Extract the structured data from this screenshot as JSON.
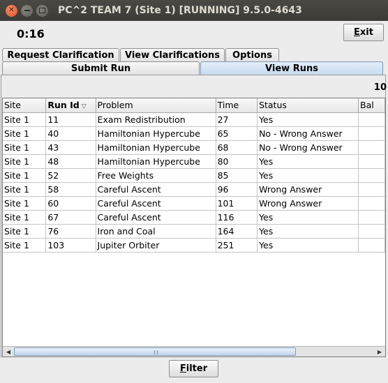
{
  "window": {
    "title": "PC^2 TEAM 7 (Site 1) [RUNNING] 9.5.0-4643"
  },
  "clock": "0:16",
  "buttons": {
    "exit_prefix": "E",
    "exit_rest": "xit",
    "filter_prefix": "F",
    "filter_rest": "ilter"
  },
  "tabs": {
    "row1": [
      "Request Clarification",
      "View Clarifications",
      "Options"
    ],
    "row2": [
      "Submit Run",
      "View Runs"
    ],
    "active": "View Runs"
  },
  "run_count": "10",
  "runs_table": {
    "sort_indicator": "▽",
    "columns": [
      "Site",
      "Run Id",
      "Problem",
      "Time",
      "Status",
      "Bal"
    ],
    "rows": [
      [
        "Site 1",
        "11",
        "Exam Redistribution",
        "27",
        "Yes"
      ],
      [
        "Site 1",
        "40",
        "Hamiltonian Hypercube",
        "65",
        "No - Wrong Answer"
      ],
      [
        "Site 1",
        "43",
        "Hamiltonian Hypercube",
        "68",
        "No - Wrong Answer"
      ],
      [
        "Site 1",
        "48",
        "Hamiltonian Hypercube",
        "80",
        "Yes"
      ],
      [
        "Site 1",
        "52",
        "Free Weights",
        "85",
        "Yes"
      ],
      [
        "Site 1",
        "58",
        "Careful Ascent",
        "96",
        "Wrong Answer"
      ],
      [
        "Site 1",
        "60",
        "Careful Ascent",
        "101",
        "Wrong Answer"
      ],
      [
        "Site 1",
        "67",
        "Careful Ascent",
        "116",
        "Yes"
      ],
      [
        "Site 1",
        "76",
        "Iron and Coal",
        "164",
        "Yes"
      ],
      [
        "Site 1",
        "103",
        "Jupiter Orbiter",
        "251",
        "Yes"
      ]
    ]
  }
}
